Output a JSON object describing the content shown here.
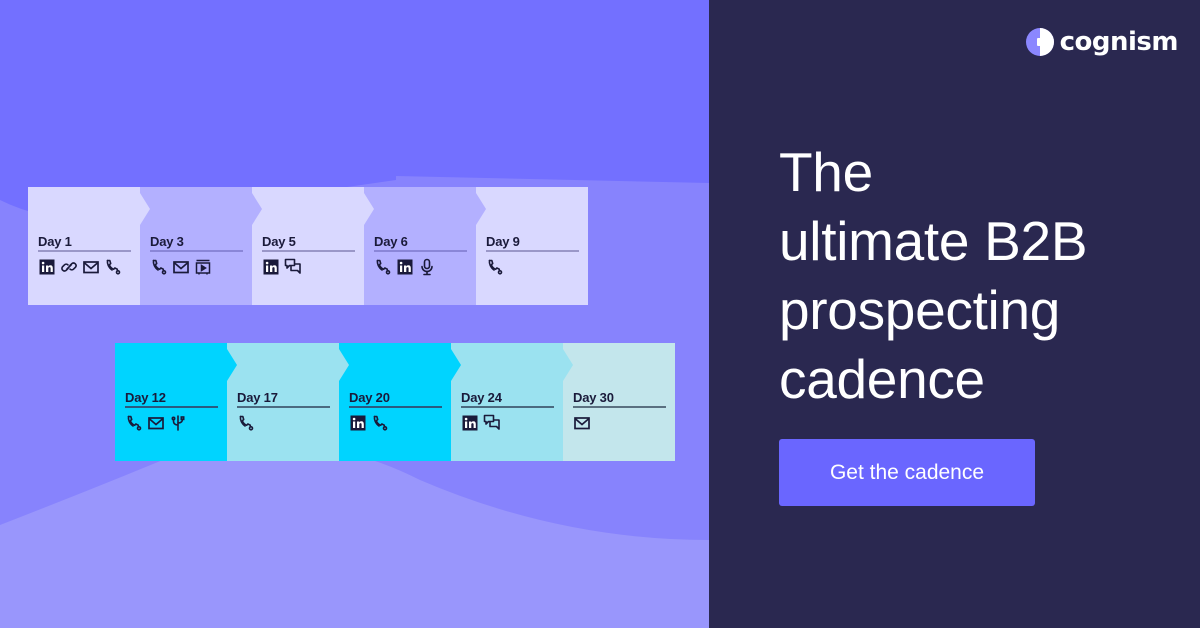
{
  "brand": {
    "name": "cognism",
    "colors": {
      "left_background": "#7370ff",
      "right_background": "#2a2850",
      "cta_background": "#6a66ff",
      "text_light": "#ffffff",
      "text_dark": "#1a1a3a"
    }
  },
  "headline": {
    "lines": [
      "The",
      "ultimate B2B",
      "prospecting",
      "cadence"
    ]
  },
  "cta": {
    "label": "Get the cadence"
  },
  "cadence": {
    "row_1": [
      {
        "label": "Day 1",
        "color": "#d9d8ff",
        "rule": "#9a97c8",
        "icons": [
          "linkedin-icon",
          "link-icon",
          "email-icon",
          "phone-icon"
        ]
      },
      {
        "label": "Day 3",
        "color": "#b3b0ff",
        "rule": "#8a86d8",
        "icons": [
          "phone-icon",
          "email-icon",
          "video-icon"
        ]
      },
      {
        "label": "Day 5",
        "color": "#d9d8ff",
        "rule": "#9a97c8",
        "icons": [
          "linkedin-icon",
          "chat-icon"
        ]
      },
      {
        "label": "Day 6",
        "color": "#b3b0ff",
        "rule": "#8a86d8",
        "icons": [
          "phone-icon",
          "linkedin-icon",
          "microphone-icon"
        ]
      },
      {
        "label": "Day 9",
        "color": "#d9d8ff",
        "rule": "#9a97c8",
        "icons": [
          "phone-icon"
        ]
      }
    ],
    "row_2": [
      {
        "label": "Day 12",
        "color": "#00d4ff",
        "rule": "#2a5a80",
        "icons": [
          "phone-icon",
          "email-icon",
          "usb-icon"
        ]
      },
      {
        "label": "Day 17",
        "color": "#9be2f0",
        "rule": "#4a6a80",
        "icons": [
          "phone-icon"
        ]
      },
      {
        "label": "Day 20",
        "color": "#00d4ff",
        "rule": "#2a5a80",
        "icons": [
          "linkedin-icon",
          "phone-icon"
        ]
      },
      {
        "label": "Day 24",
        "color": "#9be2f0",
        "rule": "#4a6a80",
        "icons": [
          "linkedin-icon",
          "chat-icon"
        ]
      },
      {
        "label": "Day 30",
        "color": "#c3e6ec",
        "rule": "#5a7080",
        "icons": [
          "email-icon"
        ]
      }
    ]
  }
}
